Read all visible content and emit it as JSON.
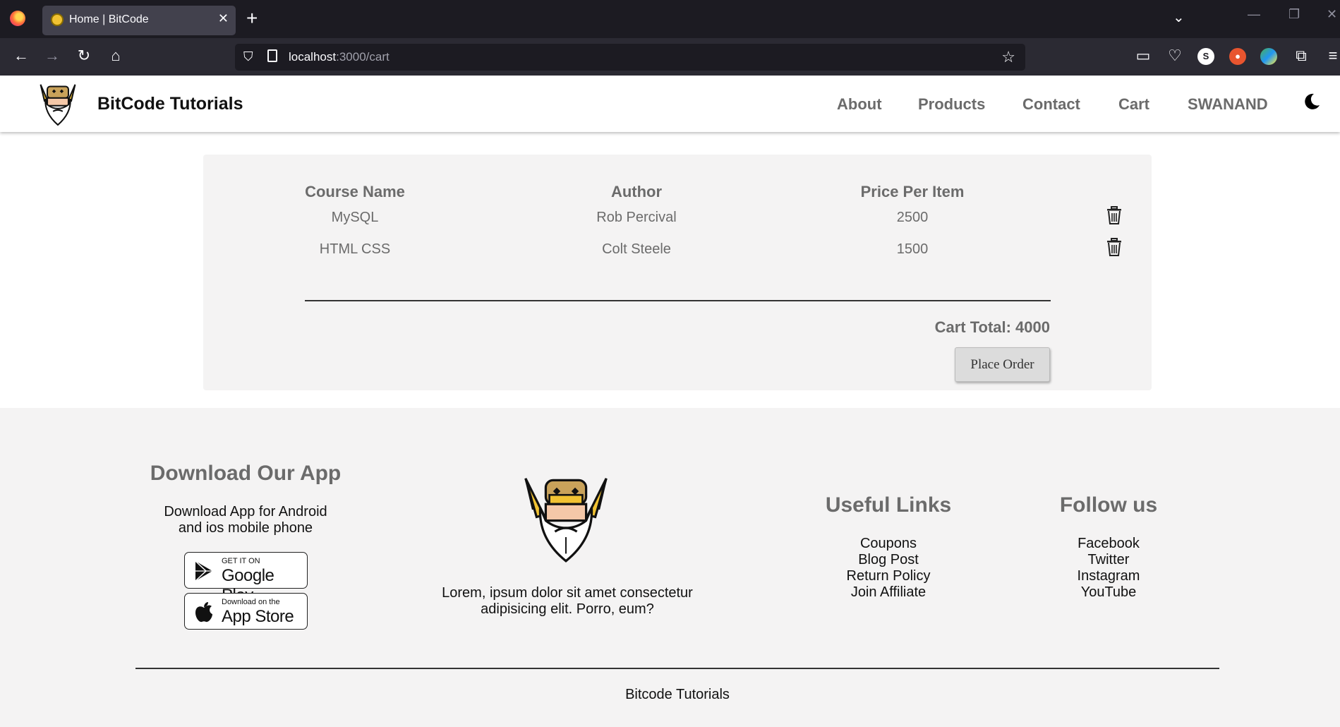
{
  "browser": {
    "tab_title": "Home | BitCode",
    "tab_close": "✕",
    "new_tab": "+",
    "url_host": "localhost",
    "url_path": ":3000/cart",
    "window_min": "—",
    "window_restore": "❐",
    "window_close": "✕"
  },
  "header": {
    "brand": "BitCode Tutorials",
    "nav": [
      "About",
      "Products",
      "Contact",
      "Cart",
      "SWANAND"
    ]
  },
  "cart": {
    "columns": [
      "Course Name",
      "Author",
      "Price Per Item"
    ],
    "rows": [
      {
        "course": "MySQL",
        "author": "Rob Percival",
        "price": "2500"
      },
      {
        "course": "HTML CSS",
        "author": "Colt Steele",
        "price": "1500"
      }
    ],
    "total_label": "Cart Total: 4000",
    "place_order": "Place Order"
  },
  "footer": {
    "download_heading": "Download Our App",
    "download_text_1": "Download App for Android",
    "download_text_2": "and ios mobile phone",
    "google_small": "GET IT ON",
    "google_big": "Google Play",
    "apple_small": "Download on the",
    "apple_big": "App Store",
    "about_text_1": "Lorem, ipsum dolor sit amet consectetur",
    "about_text_2": "adipisicing elit. Porro, eum?",
    "useful_heading": "Useful Links",
    "useful_links": [
      "Coupons",
      "Blog Post",
      "Return Policy",
      "Join Affiliate"
    ],
    "follow_heading": "Follow us",
    "follow_links": [
      "Facebook",
      "Twitter",
      "Instagram",
      "YouTube"
    ],
    "copyright": "Bitcode Tutorials"
  },
  "colors": {
    "browser_bg": "#1c1b22",
    "toolbar_bg": "#2b2a33",
    "text_gray": "#6b6b6b",
    "panel_bg": "#f4f3f3",
    "logo_gold": "#f1c232"
  }
}
